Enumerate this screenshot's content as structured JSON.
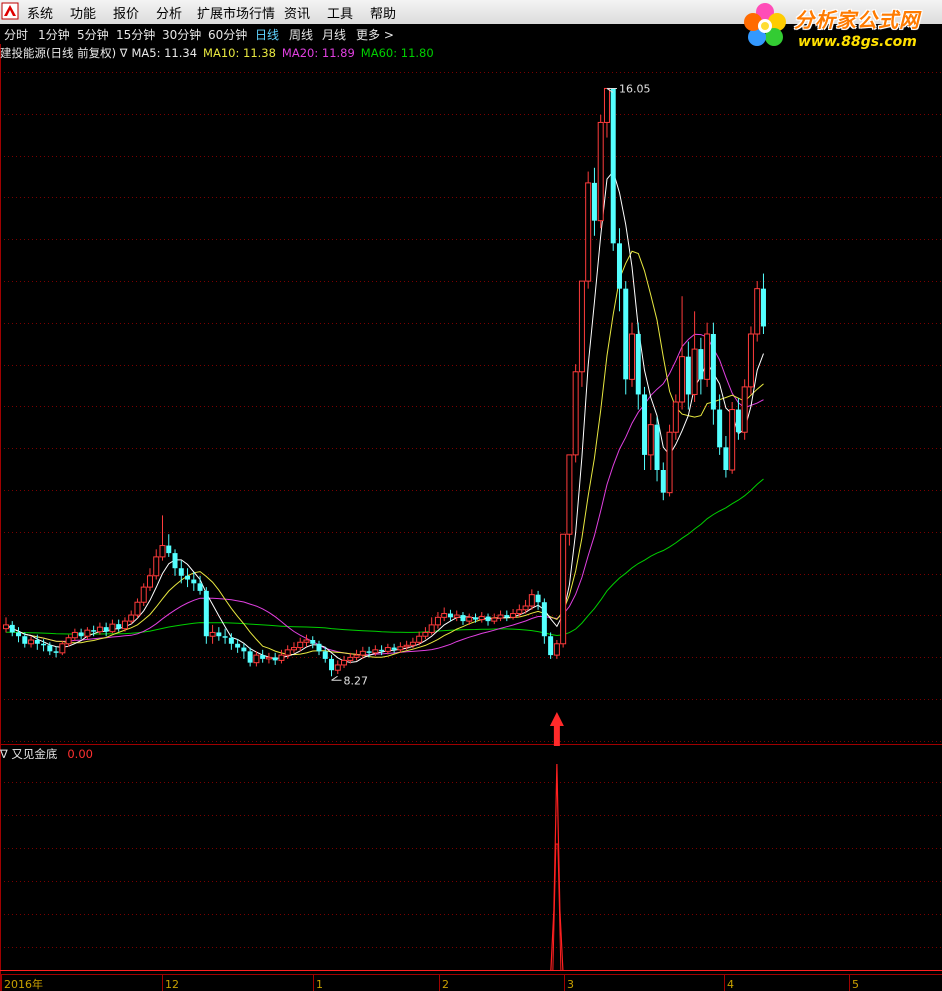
{
  "menu": {
    "items": [
      "系统",
      "功能",
      "报价",
      "分析",
      "扩展市场行情",
      "资讯",
      "工具",
      "帮助"
    ]
  },
  "brand": {
    "title": "分析家公式网",
    "url": "www.88gs.com"
  },
  "period_tabs": {
    "items": [
      "分时",
      "1分钟",
      "5分钟",
      "15分钟",
      "30分钟",
      "60分钟",
      "日线",
      "周线",
      "月线",
      "更多 >"
    ],
    "active": "日线"
  },
  "main_legend": {
    "stock_label": "建投能源(日线 前复权) ∇",
    "ma5": "MA5: 11.34",
    "ma10": "MA10: 11.38",
    "ma20": "MA20: 11.89",
    "ma60": "MA60: 11.80"
  },
  "indicator_legend": {
    "name": "∇ 又见金底",
    "value": "0.00"
  },
  "annotations": {
    "high_label": "16.05",
    "low_label": "8.27"
  },
  "x_axis": {
    "labels": [
      "2016年",
      "12",
      "1",
      "2",
      "3",
      "4",
      "5"
    ]
  },
  "colors": {
    "up": "#ff3c3c",
    "down": "#54ffff",
    "ma5": "#ffffff",
    "ma10": "#e8e840",
    "ma20": "#e040e0",
    "ma60": "#00d000",
    "signal": "#ff2020",
    "grid": "#7a0000"
  },
  "chart_data": {
    "type": "candlestick",
    "title": "建投能源(日线 前复权)",
    "price_labels": {
      "high": 16.05,
      "low": 8.27
    },
    "ylim": [
      7.4,
      16.4
    ],
    "candles_note": "approximate daily OHLC read from chart",
    "candles": [
      [
        8.9,
        8.95,
        9.05,
        8.85
      ],
      [
        8.95,
        8.85,
        9.0,
        8.8
      ],
      [
        8.85,
        8.8,
        8.92,
        8.72
      ],
      [
        8.8,
        8.7,
        8.85,
        8.65
      ],
      [
        8.7,
        8.75,
        8.8,
        8.65
      ],
      [
        8.75,
        8.7,
        8.82,
        8.62
      ],
      [
        8.7,
        8.68,
        8.76,
        8.6
      ],
      [
        8.68,
        8.6,
        8.72,
        8.55
      ],
      [
        8.6,
        8.58,
        8.66,
        8.52
      ],
      [
        8.58,
        8.7,
        8.74,
        8.55
      ],
      [
        8.7,
        8.78,
        8.82,
        8.66
      ],
      [
        8.78,
        8.85,
        8.9,
        8.74
      ],
      [
        8.85,
        8.8,
        8.9,
        8.76
      ],
      [
        8.8,
        8.88,
        8.92,
        8.76
      ],
      [
        8.88,
        8.86,
        8.94,
        8.8
      ],
      [
        8.86,
        8.92,
        8.98,
        8.82
      ],
      [
        8.92,
        8.86,
        8.98,
        8.8
      ],
      [
        8.86,
        8.96,
        9.02,
        8.84
      ],
      [
        8.96,
        8.9,
        9.02,
        8.86
      ],
      [
        8.9,
        9.0,
        9.05,
        8.86
      ],
      [
        9.0,
        9.08,
        9.14,
        8.96
      ],
      [
        9.08,
        9.25,
        9.3,
        9.04
      ],
      [
        9.25,
        9.45,
        9.5,
        9.2
      ],
      [
        9.45,
        9.6,
        9.7,
        9.4
      ],
      [
        9.6,
        9.85,
        9.95,
        9.55
      ],
      [
        9.85,
        10.0,
        10.4,
        9.8
      ],
      [
        10.0,
        9.9,
        10.15,
        9.85
      ],
      [
        9.9,
        9.7,
        9.95,
        9.6
      ],
      [
        9.7,
        9.6,
        9.8,
        9.5
      ],
      [
        9.6,
        9.55,
        9.7,
        9.45
      ],
      [
        9.55,
        9.5,
        9.65,
        9.4
      ],
      [
        9.5,
        9.4,
        9.6,
        9.35
      ],
      [
        9.4,
        8.8,
        9.45,
        8.7
      ],
      [
        8.8,
        8.85,
        8.95,
        8.7
      ],
      [
        8.85,
        8.8,
        8.92,
        8.74
      ],
      [
        8.8,
        8.78,
        8.9,
        8.7
      ],
      [
        8.78,
        8.7,
        8.84,
        8.62
      ],
      [
        8.7,
        8.65,
        8.76,
        8.58
      ],
      [
        8.65,
        8.6,
        8.7,
        8.5
      ],
      [
        8.6,
        8.45,
        8.65,
        8.4
      ],
      [
        8.45,
        8.55,
        8.6,
        8.4
      ],
      [
        8.55,
        8.5,
        8.62,
        8.45
      ],
      [
        8.5,
        8.52,
        8.58,
        8.44
      ],
      [
        8.52,
        8.48,
        8.58,
        8.42
      ],
      [
        8.48,
        8.55,
        8.62,
        8.44
      ],
      [
        8.55,
        8.62,
        8.68,
        8.5
      ],
      [
        8.62,
        8.65,
        8.72,
        8.58
      ],
      [
        8.65,
        8.72,
        8.78,
        8.6
      ],
      [
        8.72,
        8.75,
        8.82,
        8.66
      ],
      [
        8.75,
        8.7,
        8.8,
        8.64
      ],
      [
        8.7,
        8.6,
        8.74,
        8.55
      ],
      [
        8.6,
        8.5,
        8.66,
        8.45
      ],
      [
        8.5,
        8.35,
        8.55,
        8.27
      ],
      [
        8.35,
        8.42,
        8.48,
        8.3
      ],
      [
        8.42,
        8.48,
        8.54,
        8.38
      ],
      [
        8.48,
        8.52,
        8.58,
        8.44
      ],
      [
        8.52,
        8.55,
        8.62,
        8.48
      ],
      [
        8.55,
        8.6,
        8.66,
        8.5
      ],
      [
        8.6,
        8.58,
        8.66,
        8.52
      ],
      [
        8.58,
        8.62,
        8.68,
        8.54
      ],
      [
        8.62,
        8.6,
        8.68,
        8.55
      ],
      [
        8.6,
        8.65,
        8.7,
        8.56
      ],
      [
        8.65,
        8.62,
        8.7,
        8.58
      ],
      [
        8.62,
        8.66,
        8.72,
        8.58
      ],
      [
        8.66,
        8.68,
        8.74,
        8.62
      ],
      [
        8.68,
        8.72,
        8.78,
        8.64
      ],
      [
        8.72,
        8.8,
        8.86,
        8.68
      ],
      [
        8.8,
        8.85,
        8.92,
        8.76
      ],
      [
        8.85,
        8.95,
        9.05,
        8.82
      ],
      [
        8.95,
        9.05,
        9.12,
        8.9
      ],
      [
        9.05,
        9.1,
        9.18,
        9.0
      ],
      [
        9.1,
        9.05,
        9.15,
        9.0
      ],
      [
        9.05,
        9.08,
        9.14,
        9.0
      ],
      [
        9.08,
        9.0,
        9.12,
        8.95
      ],
      [
        9.0,
        9.05,
        9.1,
        8.95
      ],
      [
        9.05,
        9.02,
        9.1,
        8.98
      ],
      [
        9.02,
        9.06,
        9.12,
        8.98
      ],
      [
        9.06,
        9.0,
        9.1,
        8.94
      ],
      [
        9.0,
        9.04,
        9.1,
        8.96
      ],
      [
        9.04,
        9.08,
        9.14,
        9.0
      ],
      [
        9.08,
        9.05,
        9.14,
        9.0
      ],
      [
        9.05,
        9.1,
        9.16,
        9.02
      ],
      [
        9.1,
        9.15,
        9.22,
        9.05
      ],
      [
        9.15,
        9.2,
        9.28,
        9.1
      ],
      [
        9.2,
        9.35,
        9.42,
        9.15
      ],
      [
        9.35,
        9.25,
        9.4,
        9.15
      ],
      [
        9.25,
        8.8,
        9.3,
        8.7
      ],
      [
        8.8,
        8.55,
        8.85,
        8.5
      ],
      [
        8.55,
        8.7,
        8.75,
        8.5
      ],
      [
        8.7,
        10.15,
        10.15,
        8.65
      ],
      [
        10.15,
        11.2,
        11.2,
        10.0
      ],
      [
        11.2,
        12.3,
        12.4,
        11.1
      ],
      [
        12.3,
        13.5,
        13.5,
        12.1
      ],
      [
        13.5,
        14.8,
        14.95,
        13.4
      ],
      [
        14.8,
        14.3,
        15.0,
        14.1
      ],
      [
        14.3,
        15.6,
        15.7,
        14.2
      ],
      [
        15.6,
        16.05,
        16.05,
        15.4
      ],
      [
        16.05,
        14.0,
        16.05,
        13.9
      ],
      [
        14.0,
        13.4,
        14.2,
        13.1
      ],
      [
        13.4,
        12.2,
        13.5,
        12.0
      ],
      [
        12.2,
        12.8,
        12.95,
        12.1
      ],
      [
        12.8,
        12.0,
        12.95,
        11.8
      ],
      [
        12.0,
        11.2,
        12.1,
        11.0
      ],
      [
        11.2,
        11.6,
        11.75,
        11.0
      ],
      [
        11.6,
        11.0,
        11.7,
        10.85
      ],
      [
        11.0,
        10.7,
        11.1,
        10.6
      ],
      [
        10.7,
        11.5,
        11.6,
        10.65
      ],
      [
        11.5,
        11.9,
        12.0,
        11.4
      ],
      [
        11.9,
        12.5,
        13.3,
        11.8
      ],
      [
        12.5,
        12.0,
        12.7,
        11.8
      ],
      [
        12.0,
        12.6,
        13.1,
        11.9
      ],
      [
        12.6,
        12.2,
        12.75,
        12.0
      ],
      [
        12.2,
        12.8,
        12.95,
        12.1
      ],
      [
        12.8,
        11.8,
        12.95,
        11.6
      ],
      [
        11.8,
        11.3,
        12.0,
        11.2
      ],
      [
        11.3,
        11.0,
        11.45,
        10.9
      ],
      [
        11.0,
        11.8,
        11.9,
        10.95
      ],
      [
        11.8,
        11.5,
        11.95,
        11.4
      ],
      [
        11.5,
        12.1,
        12.2,
        11.4
      ],
      [
        12.1,
        12.8,
        12.9,
        12.0
      ],
      [
        12.8,
        13.4,
        13.5,
        12.7
      ],
      [
        13.4,
        12.9,
        13.6,
        12.8
      ]
    ],
    "indicator": {
      "name": "又见金底",
      "value": 0.0,
      "signal_index": 88,
      "signal_peak": 1
    }
  }
}
